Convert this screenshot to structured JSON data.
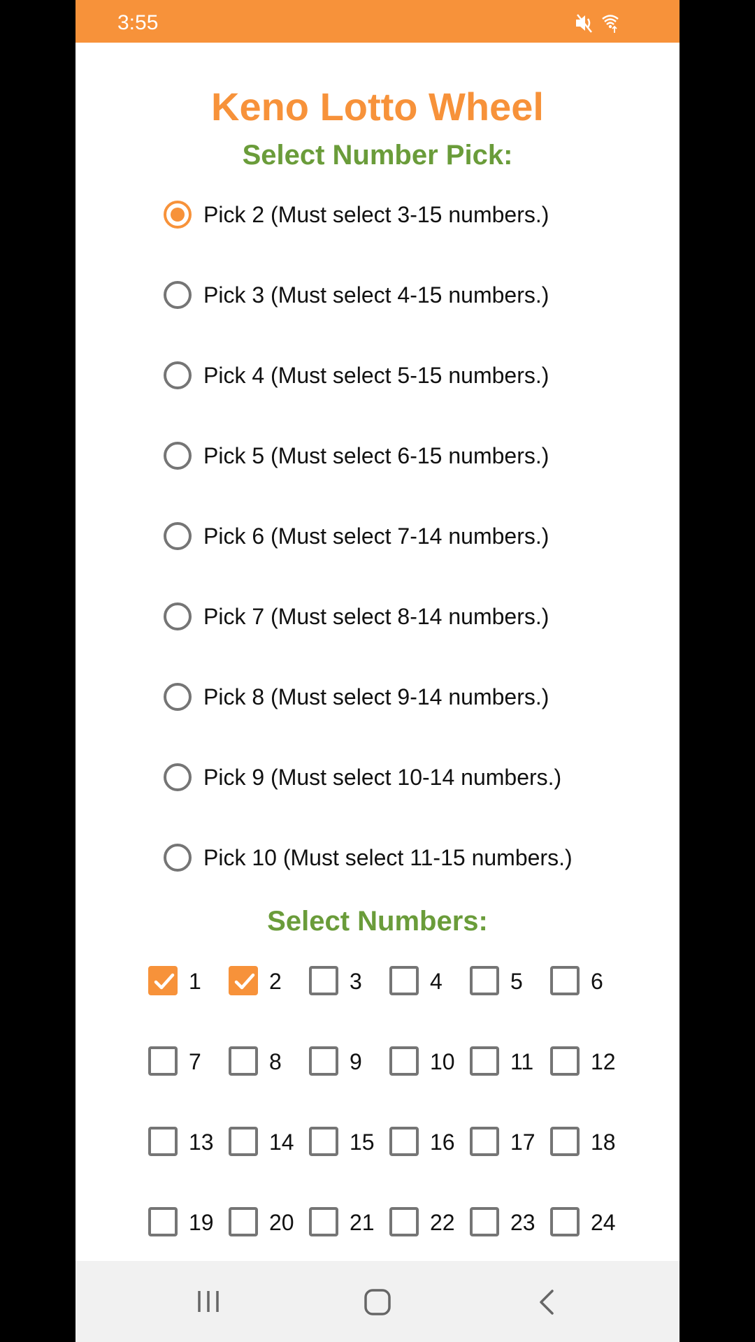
{
  "status_bar": {
    "time": "3:55",
    "icons": [
      "mute-icon",
      "wifi-icon"
    ]
  },
  "app": {
    "title": "Keno Lotto Wheel",
    "pick_section_title": "Select Number Pick:",
    "numbers_section_title": "Select Numbers:"
  },
  "picks": [
    {
      "label": "Pick 2 (Must select 3-15 numbers.)",
      "selected": true
    },
    {
      "label": "Pick 3 (Must select 4-15 numbers.)",
      "selected": false
    },
    {
      "label": "Pick 4 (Must select 5-15 numbers.)",
      "selected": false
    },
    {
      "label": "Pick 5 (Must select 6-15 numbers.)",
      "selected": false
    },
    {
      "label": "Pick 6 (Must select 7-14 numbers.)",
      "selected": false
    },
    {
      "label": "Pick 7 (Must select 8-14 numbers.)",
      "selected": false
    },
    {
      "label": "Pick 8 (Must select 9-14 numbers.)",
      "selected": false
    },
    {
      "label": "Pick 9 (Must select 10-14 numbers.)",
      "selected": false
    },
    {
      "label": "Pick 10 (Must select 11-15 numbers.)",
      "selected": false
    }
  ],
  "numbers": [
    {
      "label": "1",
      "checked": true
    },
    {
      "label": "2",
      "checked": true
    },
    {
      "label": "3",
      "checked": false
    },
    {
      "label": "4",
      "checked": false
    },
    {
      "label": "5",
      "checked": false
    },
    {
      "label": "6",
      "checked": false
    },
    {
      "label": "7",
      "checked": false
    },
    {
      "label": "8",
      "checked": false
    },
    {
      "label": "9",
      "checked": false
    },
    {
      "label": "10",
      "checked": false
    },
    {
      "label": "11",
      "checked": false
    },
    {
      "label": "12",
      "checked": false
    },
    {
      "label": "13",
      "checked": false
    },
    {
      "label": "14",
      "checked": false
    },
    {
      "label": "15",
      "checked": false
    },
    {
      "label": "16",
      "checked": false
    },
    {
      "label": "17",
      "checked": false
    },
    {
      "label": "18",
      "checked": false
    },
    {
      "label": "19",
      "checked": false
    },
    {
      "label": "20",
      "checked": false
    },
    {
      "label": "21",
      "checked": false
    },
    {
      "label": "22",
      "checked": false
    },
    {
      "label": "23",
      "checked": false
    },
    {
      "label": "24",
      "checked": false
    }
  ],
  "nav_bar": {
    "buttons": [
      "recent-apps-icon",
      "home-icon",
      "back-icon"
    ]
  },
  "colors": {
    "accent": "#f7923a",
    "section_green": "#6a9c3a",
    "unchecked_gray": "#757575"
  }
}
